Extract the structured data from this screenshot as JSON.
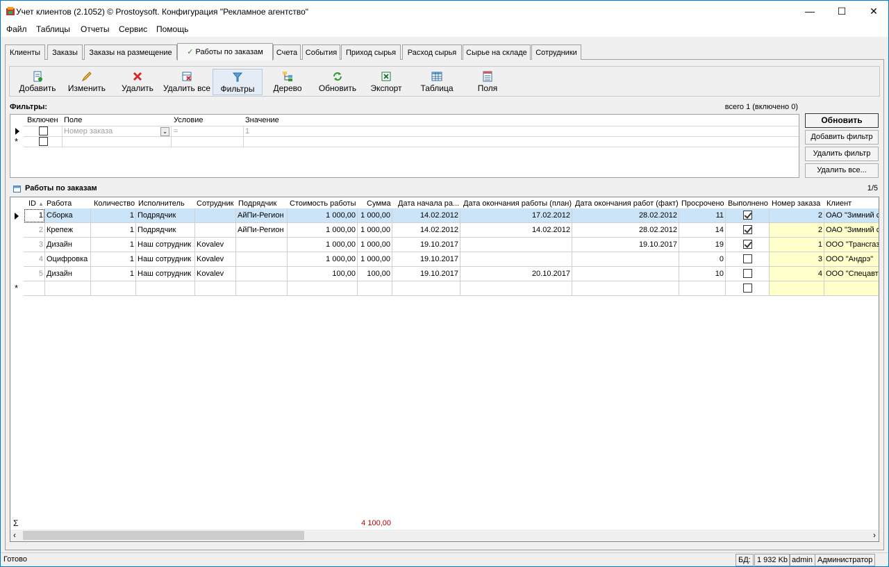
{
  "window": {
    "title": "Учет клиентов (2.1052) © Prostoysoft. Конфигурация \"Рекламное агентство\"",
    "minimize": "—",
    "maximize": "☐",
    "close": "✕"
  },
  "menu": [
    "Файл",
    "Таблицы",
    "Отчеты",
    "Сервис",
    "Помощь"
  ],
  "tabs": [
    "Клиенты",
    "Заказы",
    "Заказы на размещение",
    "Работы по заказам",
    "Счета",
    "События",
    "Приход сырья",
    "Расход сырья",
    "Сырье на складе",
    "Сотрудники"
  ],
  "active_tab_check": "✓",
  "toolbar": {
    "add": "Добавить",
    "edit": "Изменить",
    "delete": "Удалить",
    "delete_all": "Удалить все",
    "filters": "Фильтры",
    "tree": "Дерево",
    "refresh": "Обновить",
    "export": "Экспорт",
    "table": "Таблица",
    "fields": "Поля"
  },
  "filters": {
    "header": "Фильтры:",
    "count": "всего 1 (включено 0)",
    "col_enabled": "Включен",
    "col_field": "Поле",
    "col_condition": "Условие",
    "col_value": "Значение",
    "row_field": "Номер заказа",
    "row_condition": "=",
    "row_value": "1",
    "btn_refresh": "Обновить",
    "btn_add": "Добавить фильтр",
    "btn_delete": "Удалить фильтр",
    "btn_delete_all": "Удалить все..."
  },
  "section": {
    "title": "Работы по заказам",
    "counter": "1/5"
  },
  "grid": {
    "headers": {
      "id": "ID",
      "sort_arrow": "▲",
      "work": "Работа",
      "qty": "Количество",
      "executor": "Исполнитель",
      "employee": "Сотрудник",
      "contractor": "Подрядчик",
      "cost": "Стоимость работы",
      "sum": "Сумма",
      "start": "Дата начала ра...",
      "end_plan": "Дата окончания работы (план)",
      "end_fact": "Дата окончания работ (факт)",
      "overdue": "Просрочено",
      "done": "Выполнено",
      "order_no": "Номер заказа",
      "client": "Клиент"
    },
    "rows": [
      {
        "id": "1",
        "work": "Сборка",
        "qty": "1",
        "executor": "Подрядчик",
        "employee": "",
        "contractor": "АйПи-Регион",
        "cost": "1 000,00",
        "sum": "1 000,00",
        "start": "14.02.2012",
        "end_plan": "17.02.2012",
        "end_fact": "28.02.2012",
        "overdue": "11",
        "done": true,
        "order_no": "2",
        "client": "ОАО \"Зимний сад\""
      },
      {
        "id": "2",
        "work": "Крепеж",
        "qty": "1",
        "executor": "Подрядчик",
        "employee": "",
        "contractor": "АйПи-Регион",
        "cost": "1 000,00",
        "sum": "1 000,00",
        "start": "14.02.2012",
        "end_plan": "14.02.2012",
        "end_fact": "28.02.2012",
        "overdue": "14",
        "done": true,
        "order_no": "2",
        "client": "ОАО \"Зимний сад\""
      },
      {
        "id": "3",
        "work": "Дизайн",
        "qty": "1",
        "executor": "Наш сотрудник",
        "employee": "Kovalev",
        "contractor": "",
        "cost": "1 000,00",
        "sum": "1 000,00",
        "start": "19.10.2017",
        "end_plan": "",
        "end_fact": "19.10.2017",
        "overdue": "19",
        "done": true,
        "order_no": "1",
        "client": "ООО \"Трансгаз\""
      },
      {
        "id": "4",
        "work": "Оцифровка",
        "qty": "1",
        "executor": "Наш сотрудник",
        "employee": "Kovalev",
        "contractor": "",
        "cost": "1 000,00",
        "sum": "1 000,00",
        "start": "19.10.2017",
        "end_plan": "",
        "end_fact": "",
        "overdue": "0",
        "done": false,
        "order_no": "3",
        "client": "ООО \"Андрэ\""
      },
      {
        "id": "5",
        "work": "Дизайн",
        "qty": "1",
        "executor": "Наш сотрудник",
        "employee": "Kovalev",
        "contractor": "",
        "cost": "100,00",
        "sum": "100,00",
        "start": "19.10.2017",
        "end_plan": "20.10.2017",
        "end_fact": "",
        "overdue": "10",
        "done": false,
        "order_no": "4",
        "client": "ООО \"Спецавтоматика\""
      }
    ],
    "sum_symbol": "Σ",
    "sum_total": "4 100,00"
  },
  "status": {
    "ready": "Готово",
    "db_label": "БД:",
    "db_size": "1 932 Kb",
    "user": "admin",
    "role": "Администратор"
  },
  "colors": {
    "accent": "#0078d7",
    "selected_row": "#cce4f7",
    "highlight": "#ffffcc",
    "sum_text": "#c00000"
  }
}
